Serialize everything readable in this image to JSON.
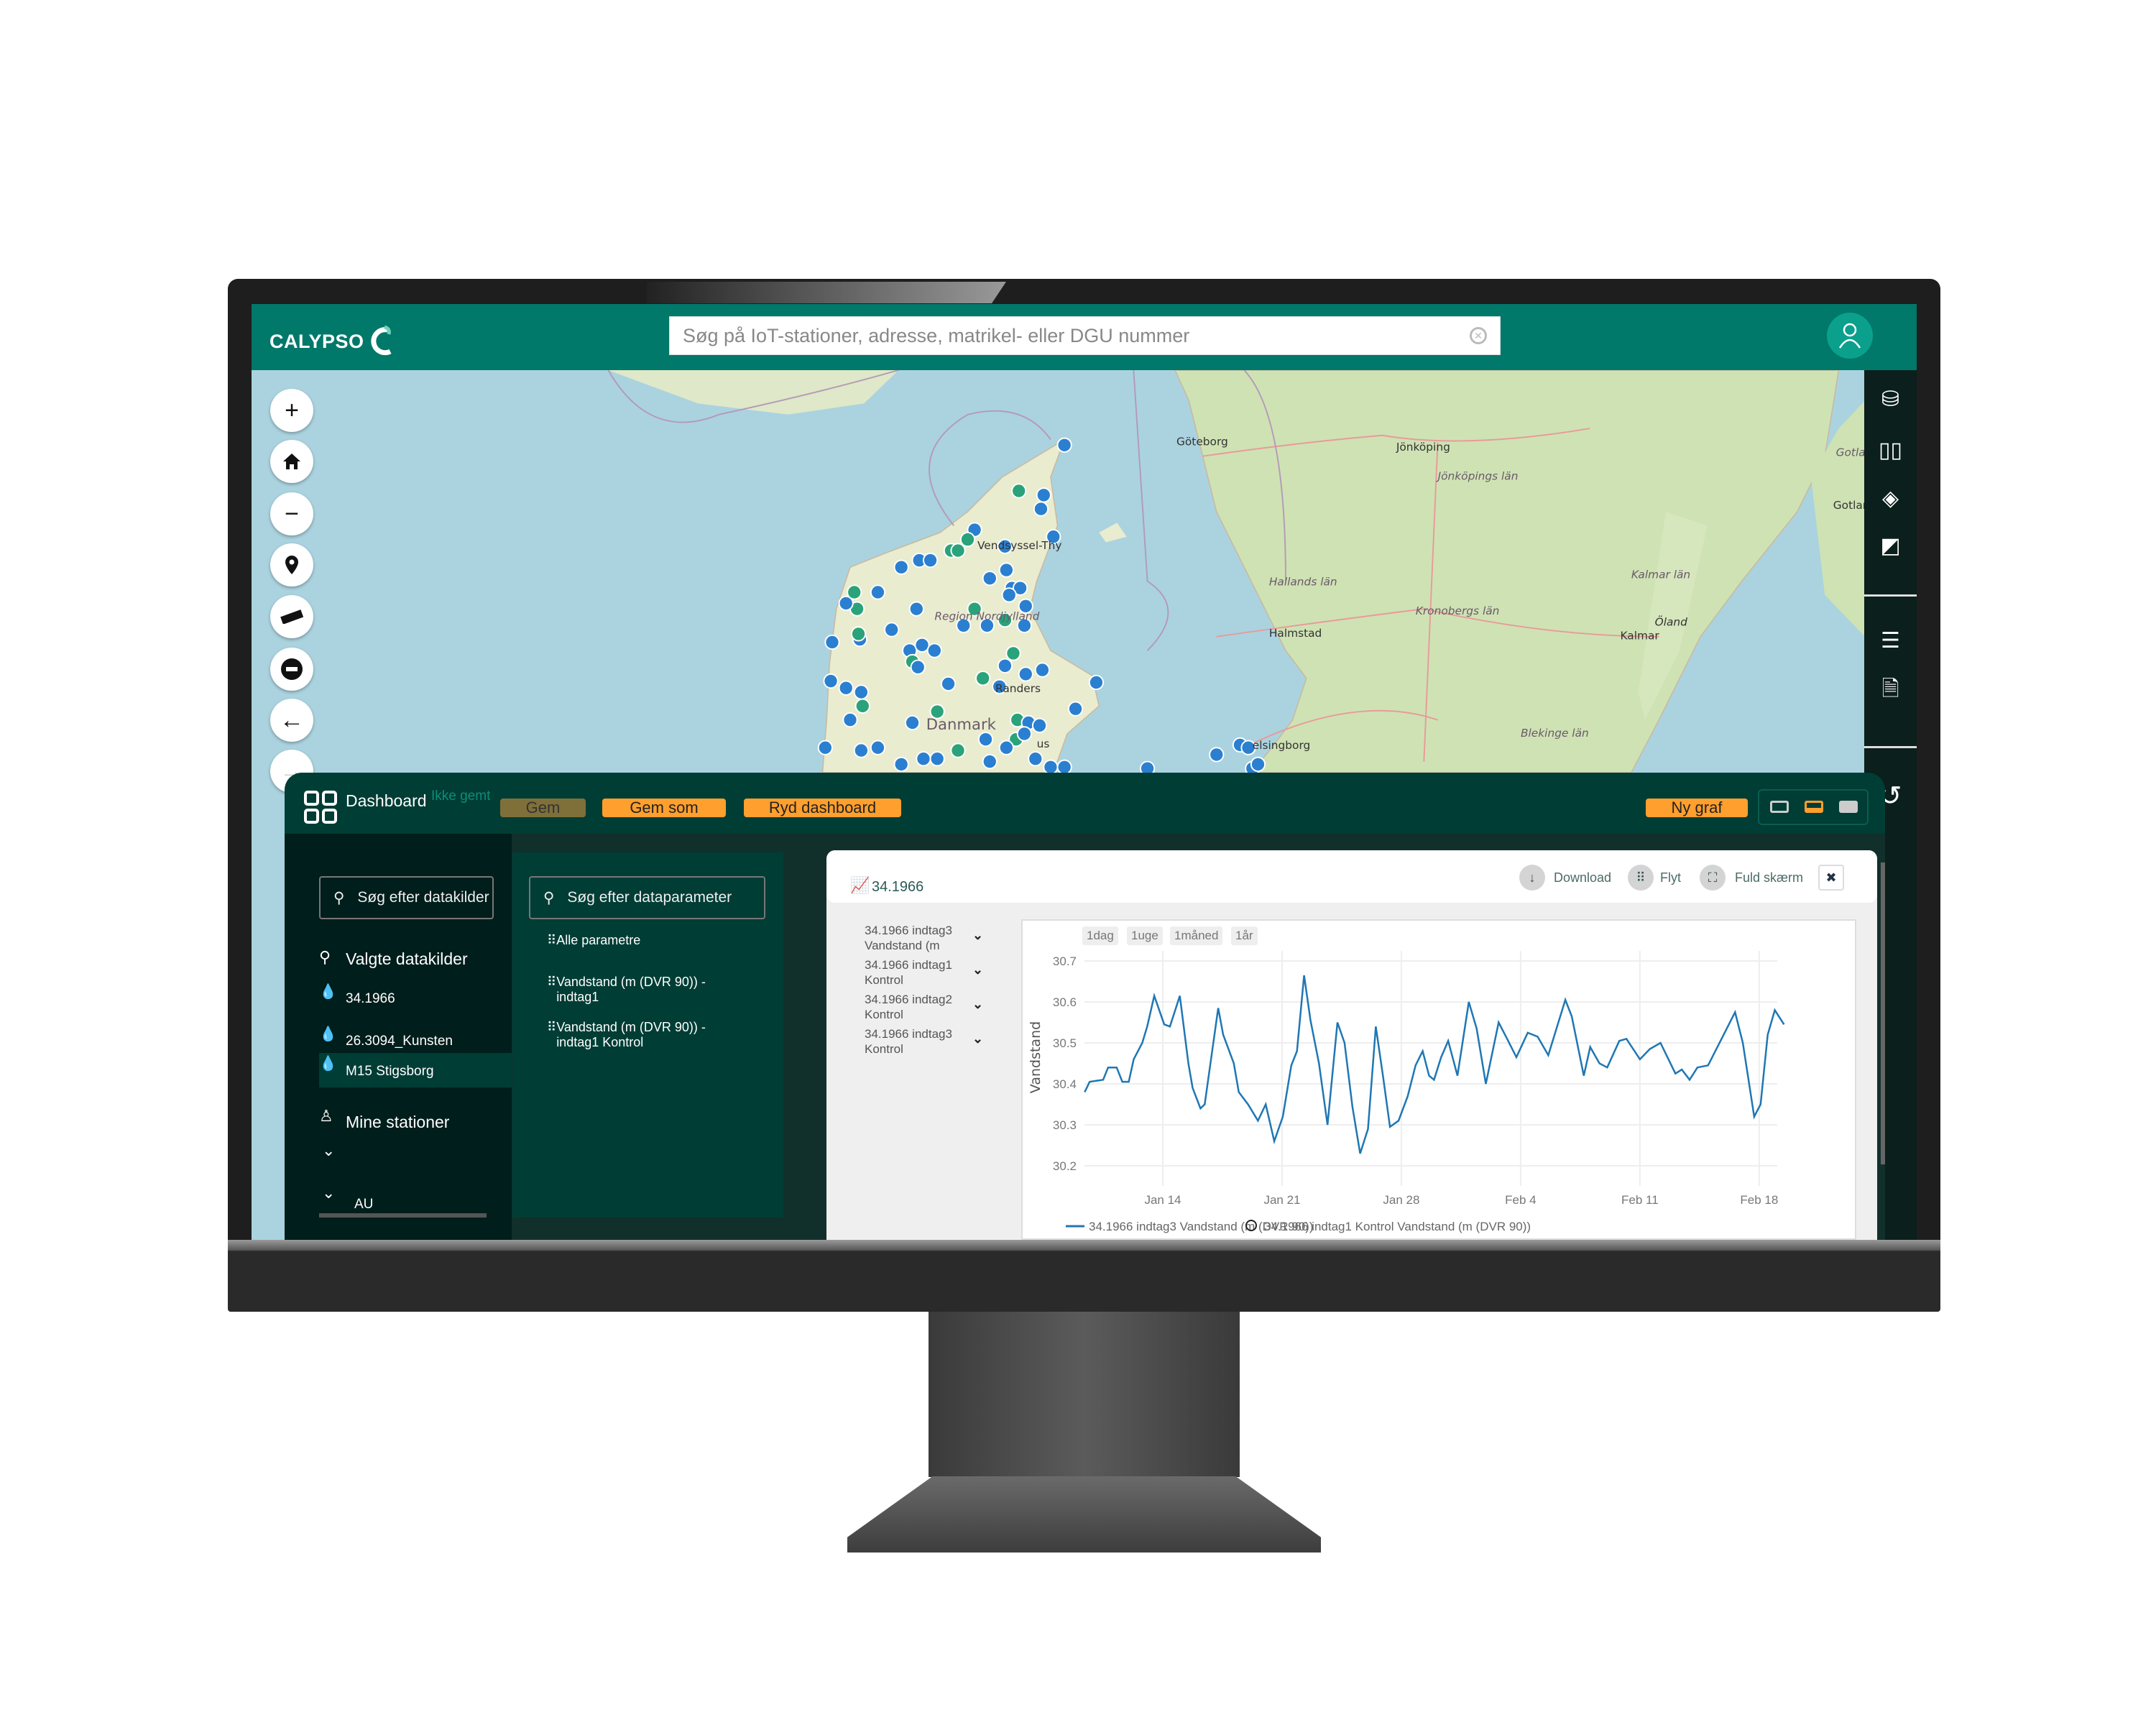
{
  "app": {
    "name": "CALYPSO",
    "search_placeholder": "Søg på IoT-stationer, adresse, matrikel- eller DGU nummer"
  },
  "map": {
    "labels": {
      "goteborg": "Göteborg",
      "jonkoping": "Jönköping",
      "jonkopings_lan": "Jönköpings län",
      "hallands_lan": "Hallands län",
      "halmstad": "Halmstad",
      "kronobergs_lan": "Kronobergs län",
      "kalmar_lan": "Kalmar län",
      "oland": "Öland",
      "kalmar": "Kalmar",
      "blekinge_lan": "Blekinge län",
      "helsingborg": "elsingborg",
      "vendsyssel": "Vendsyssel-Thy",
      "region": "Region Nordjylland",
      "randers": "Randers",
      "danmark": "Danmark",
      "aarhus": "us",
      "gotland_lan": "Gotland län",
      "gotland": "Gotland"
    },
    "colors": {
      "water": "#aad3df",
      "land": "#dfe8c8",
      "forest": "#c4dcaa",
      "marker_blue": "#2b7fd0",
      "marker_green": "#2aa37a"
    },
    "controls": [
      "zoom-in",
      "home",
      "zoom-out",
      "location-pin",
      "measure-ruler",
      "remove",
      "back",
      "forward"
    ]
  },
  "right_toolbar": [
    "database",
    "grid",
    "layers",
    "map-print",
    "list",
    "excel-file",
    "undo"
  ],
  "dashboard": {
    "title": "Dashboard",
    "status": "Ikke gemt",
    "buttons": {
      "save": "Gem",
      "save_as": "Gem som",
      "clear": "Ryd dashboard",
      "new_graph": "Ny graf"
    },
    "layout_options": [
      "single",
      "half",
      "full"
    ],
    "selected_layout": "half",
    "sources_search_placeholder": "Søg efter datakilder",
    "params_search_placeholder": "Søg efter dataparameter",
    "selected_sources_title": "Valgte datakilder",
    "sources": [
      {
        "name": "34.1966"
      },
      {
        "name": "26.3094_Kunsten"
      },
      {
        "name": "M15 Stigsborg",
        "selected": true
      }
    ],
    "my_stations": "Mine stationer",
    "group": "AU",
    "params": [
      "Alle parametre",
      "Vandstand (m (DVR 90)) -\nindtag1",
      "Vandstand (m (DVR 90)) -\nindtag1 Kontrol"
    ]
  },
  "graph_card": {
    "title": "34.1966",
    "actions": {
      "download": "Download",
      "move": "Flyt",
      "fullscreen": "Fuld skærm"
    },
    "series_list": [
      "34.1966 indtag3\nVandstand (m",
      "34.1966 indtag1\nKontrol",
      "34.1966 indtag2\nKontrol",
      "34.1966 indtag3\nKontrol"
    ],
    "range_buttons": [
      "1dag",
      "1uge",
      "1måned",
      "1år"
    ]
  },
  "chart_data": {
    "type": "line",
    "ylabel": "Vandstand",
    "xlabel": "",
    "ylim": [
      30.15,
      30.725
    ],
    "xlim": [
      "Jan 9 10:00",
      "Feb 19 11:00"
    ],
    "xticks": [
      "Jan 14",
      "Jan 21",
      "Jan 28",
      "Feb 4",
      "Feb 11",
      "Feb 18"
    ],
    "yticks": [
      30.2,
      30.3,
      30.4,
      30.5,
      30.6,
      30.7
    ],
    "grid": true,
    "legend_position": "bottom",
    "series": [
      {
        "name": "34.1966 indtag3 Vandstand (m (DVR 90))",
        "color": "#1f77b4",
        "x": [
          "Jan 9 10:00",
          "Jan 9 17:00",
          "Jan 10 12:00",
          "Jan 10 19:00",
          "Jan 11 07:00",
          "Jan 11 15:00",
          "Jan 12 00:00",
          "Jan 12 07:00",
          "Jan 12 19:00",
          "Jan 13 02:00",
          "Jan 13 12:00",
          "Jan 14 02:00",
          "Jan 14 10:00",
          "Jan 15 00:00",
          "Jan 15 12:00",
          "Jan 15 18:00",
          "Jan 16 05:00",
          "Jan 16 11:00",
          "Jan 17 06:00",
          "Jan 17 13:00",
          "Jan 18 04:00",
          "Jan 18 11:00",
          "Jan 19 00:00",
          "Jan 19 14:00",
          "Jan 20 01:00",
          "Jan 20 13:00",
          "Jan 21 01:00",
          "Jan 21 13:00",
          "Jan 21 21:00",
          "Jan 22 07:00",
          "Jan 22 16:00",
          "Jan 23 04:00",
          "Jan 23 16:00",
          "Jan 24 06:00",
          "Jan 24 16:00",
          "Jan 25 03:00",
          "Jan 25 14:00",
          "Jan 26 01:00",
          "Jan 26 12:00",
          "Jan 26 22:00",
          "Jan 27 08:00",
          "Jan 27 20:00",
          "Jan 28 09:00",
          "Jan 28 20:00",
          "Jan 29 06:00",
          "Jan 29 15:00",
          "Jan 29 22:00",
          "Jan 30 08:00",
          "Jan 30 18:00",
          "Jan 31 07:00",
          "Jan 31 23:00",
          "Feb 1 10:00",
          "Feb 1 23:00",
          "Feb 2 17:00",
          "Feb 3 05:00",
          "Feb 3 18:00",
          "Feb 4 10:00",
          "Feb 5 00:00",
          "Feb 5 15:00",
          "Feb 6 15:00",
          "Feb 7 00:00",
          "Feb 7 17:00",
          "Feb 8 02:00",
          "Feb 8 15:00",
          "Feb 9 02:00",
          "Feb 9 19:00",
          "Feb 10 05:00",
          "Feb 11 00:00",
          "Feb 11 14:00",
          "Feb 12 05:00",
          "Feb 13 02:00",
          "Feb 13 11:00",
          "Feb 13 22:00",
          "Feb 14 09:00",
          "Feb 15 00:00",
          "Feb 15 19:00",
          "Feb 16 14:00",
          "Feb 17 01:00",
          "Feb 17 17:00",
          "Feb 18 02:00",
          "Feb 18 12:00",
          "Feb 18 22:00",
          "Feb 19 11:00"
        ],
        "y": [
          30.38,
          30.405,
          30.41,
          30.44,
          30.44,
          30.405,
          30.405,
          30.46,
          30.5,
          30.54,
          30.615,
          30.545,
          30.54,
          30.615,
          30.45,
          30.39,
          30.34,
          30.35,
          30.585,
          30.52,
          30.45,
          30.38,
          30.35,
          30.31,
          30.35,
          30.26,
          30.32,
          30.445,
          30.48,
          30.665,
          30.555,
          30.45,
          30.3,
          30.55,
          30.5,
          30.345,
          30.23,
          30.29,
          30.54,
          30.42,
          30.295,
          30.31,
          30.37,
          30.445,
          30.48,
          30.42,
          30.41,
          30.465,
          30.505,
          30.42,
          30.6,
          30.535,
          30.4,
          30.55,
          30.51,
          30.465,
          30.525,
          30.515,
          30.47,
          30.605,
          30.565,
          30.42,
          30.49,
          30.45,
          30.44,
          30.505,
          30.51,
          30.46,
          30.485,
          30.5,
          30.425,
          30.435,
          30.41,
          30.44,
          30.445,
          30.51,
          30.575,
          30.5,
          30.32,
          30.35,
          30.52,
          30.58,
          30.545
        ]
      },
      {
        "name": "34.1966 indtag1 Kontrol Vandstand (m (DVR 90))",
        "x": [],
        "y": []
      }
    ]
  }
}
